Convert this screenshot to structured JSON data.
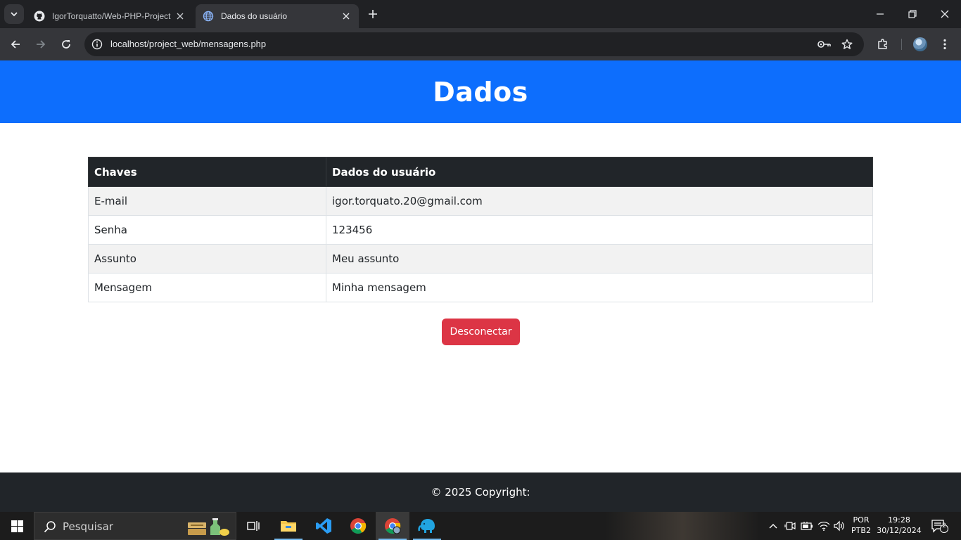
{
  "browser": {
    "tabs": [
      {
        "title": "IgorTorquatto/Web-PHP-Project",
        "favicon": "github-icon",
        "active": false
      },
      {
        "title": "Dados do usuário",
        "favicon": "globe-icon",
        "active": true
      }
    ],
    "url": "localhost/project_web/mensagens.php"
  },
  "page": {
    "header_title": "Dados",
    "table": {
      "headers": [
        "Chaves",
        "Dados do usuário"
      ],
      "rows": [
        [
          "E-mail",
          "igor.torquato.20@gmail.com"
        ],
        [
          "Senha",
          "123456"
        ],
        [
          "Assunto",
          "Meu assunto"
        ],
        [
          "Mensagem",
          "Minha mensagem"
        ]
      ]
    },
    "disconnect_label": "Desconectar",
    "footer_text": "© 2025 Copyright:"
  },
  "taskbar": {
    "search_placeholder": "Pesquisar",
    "language": "POR",
    "keyboard": "PTB2",
    "time": "19:28",
    "date": "30/12/2024",
    "notification_count": "2"
  },
  "colors": {
    "header_bg": "#0d6efd",
    "table_head_bg": "#212529",
    "danger": "#dc3545",
    "footer_bg": "#212529"
  }
}
